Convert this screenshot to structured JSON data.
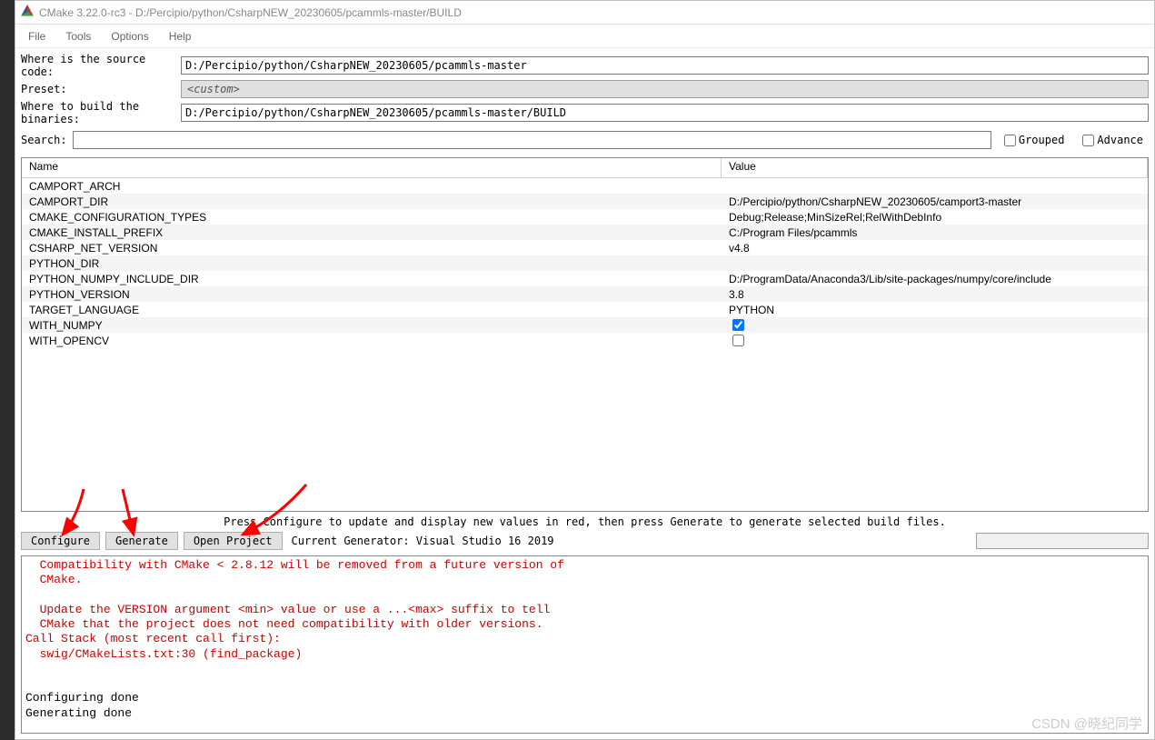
{
  "window": {
    "title": "CMake 3.22.0-rc3 - D:/Percipio/python/CsharpNEW_20230605/pcammls-master/BUILD"
  },
  "menu": {
    "file": "File",
    "tools": "Tools",
    "options": "Options",
    "help": "Help"
  },
  "paths": {
    "source_label": "Where is the source code:",
    "source_value": "D:/Percipio/python/CsharpNEW_20230605/pcammls-master",
    "preset_label": "Preset:",
    "preset_value": "<custom>",
    "build_label": "Where to build the binaries:",
    "build_value": "D:/Percipio/python/CsharpNEW_20230605/pcammls-master/BUILD"
  },
  "search": {
    "label": "Search:",
    "value": "",
    "grouped_label": "Grouped",
    "advanced_label": "Advance"
  },
  "table": {
    "name_header": "Name",
    "value_header": "Value",
    "rows": [
      {
        "name": "CAMPORT_ARCH",
        "value": ""
      },
      {
        "name": "CAMPORT_DIR",
        "value": "D:/Percipio/python/CsharpNEW_20230605/camport3-master"
      },
      {
        "name": "CMAKE_CONFIGURATION_TYPES",
        "value": "Debug;Release;MinSizeRel;RelWithDebInfo"
      },
      {
        "name": "CMAKE_INSTALL_PREFIX",
        "value": "C:/Program Files/pcammls"
      },
      {
        "name": "CSHARP_NET_VERSION",
        "value": "v4.8"
      },
      {
        "name": "PYTHON_DIR",
        "value": ""
      },
      {
        "name": "PYTHON_NUMPY_INCLUDE_DIR",
        "value": "D:/ProgramData/Anaconda3/Lib/site-packages/numpy/core/include"
      },
      {
        "name": "PYTHON_VERSION",
        "value": "3.8"
      },
      {
        "name": "TARGET_LANGUAGE",
        "value": "PYTHON"
      },
      {
        "name": "WITH_NUMPY",
        "value": true,
        "checkbox": true
      },
      {
        "name": "WITH_OPENCV",
        "value": false,
        "checkbox": true
      }
    ]
  },
  "hint": "Press Configure to update and display new values in red, then press Generate to generate selected build files.",
  "buttons": {
    "configure": "Configure",
    "generate": "Generate",
    "open_project": "Open Project",
    "generator_label": "Current Generator: Visual Studio 16 2019"
  },
  "output": {
    "lines": [
      {
        "text": "  Compatibility with CMake < 2.8.12 will be removed from a future version of",
        "red": true
      },
      {
        "text": "  CMake.",
        "red": true
      },
      {
        "text": "",
        "red": true
      },
      {
        "text": "  Update the VERSION argument <min> value or use a ...<max> suffix to tell",
        "red": true
      },
      {
        "text": "  CMake that the project does not need compatibility with older versions.",
        "red": true
      },
      {
        "text": "Call Stack (most recent call first):",
        "red": true
      },
      {
        "text": "  swig/CMakeLists.txt:30 (find_package)",
        "red": true
      },
      {
        "text": "",
        "red": false
      },
      {
        "text": "",
        "red": false
      },
      {
        "text": "Configuring done",
        "red": false
      },
      {
        "text": "Generating done",
        "red": false
      }
    ]
  },
  "watermark": "CSDN @晓纪同学"
}
